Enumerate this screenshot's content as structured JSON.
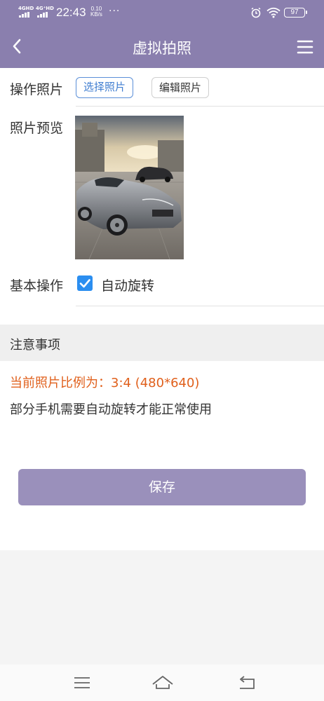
{
  "status_bar": {
    "network1": "4GHD",
    "network2": "4G⁺HD",
    "time": "22:43",
    "speed_value": "0.10",
    "speed_unit": "KB/s",
    "more": "···",
    "battery": "97",
    "icons": [
      "signal-icon",
      "alarm-icon",
      "wifi-icon",
      "battery-icon"
    ]
  },
  "header": {
    "title": "虚拟拍照",
    "back_icon": "chevron-left-icon",
    "menu_icon": "hamburger-menu-icon",
    "background": "#8a7fae"
  },
  "photo_ops": {
    "label": "操作照片",
    "select_button": "选择照片",
    "edit_button": "编辑照片"
  },
  "preview": {
    "label": "照片预览"
  },
  "basic_ops": {
    "label": "基本操作",
    "checkbox_label": "自动旋转",
    "checked": true
  },
  "notice": {
    "title": "注意事项",
    "ratio_text": "当前照片比例为：3:4 (480*640)",
    "tip_text": "部分手机需要自动旋转才能正常使用"
  },
  "save_button": "保存",
  "colors": {
    "accent": "#8a7fae",
    "save_button": "#9a90bb",
    "checkbox": "#2b8ef0",
    "warning_text": "#e0601c",
    "select_border": "#5b8fd8"
  },
  "nav_bar": {
    "icons": [
      "menu-lines-icon",
      "home-icon",
      "back-icon"
    ]
  }
}
